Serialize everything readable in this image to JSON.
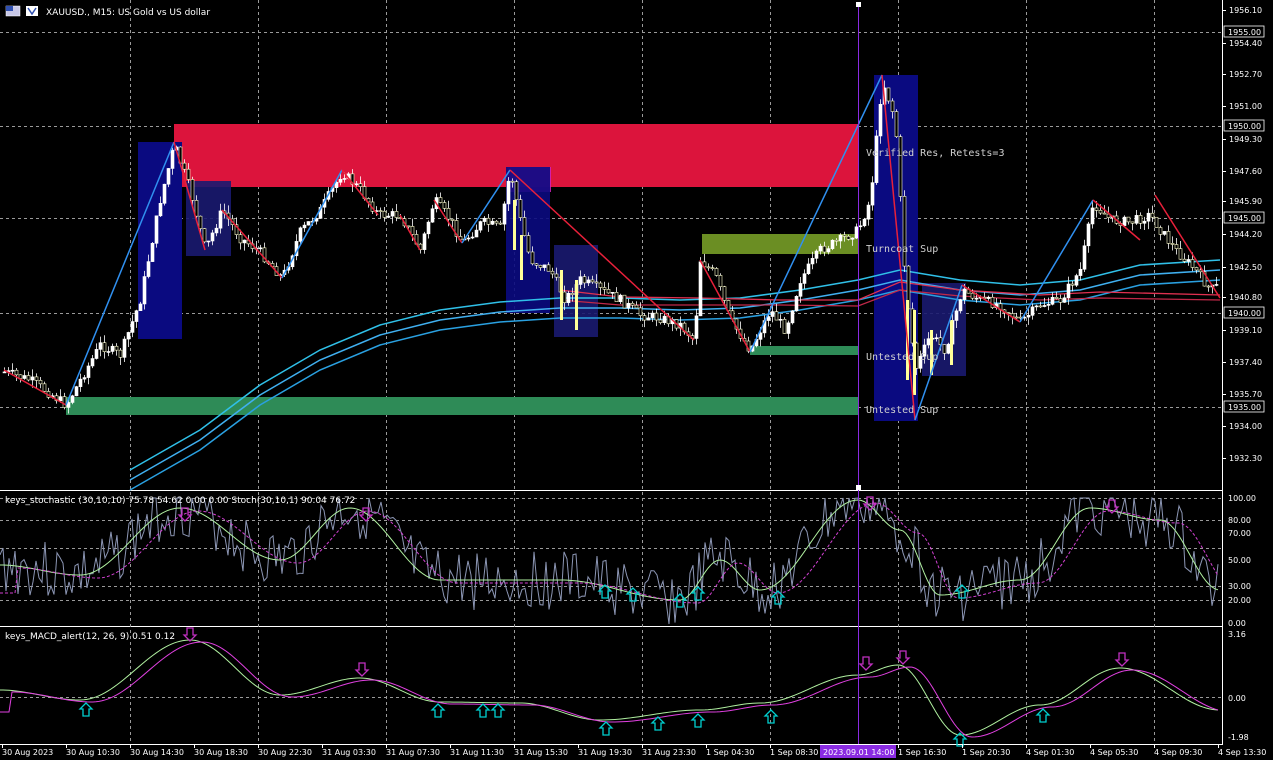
{
  "window": {
    "symbol_title": "XAUUSD., M15:  US Gold vs US dollar"
  },
  "indicators": {
    "stoch_label": "keys_stochastic (30,10,10) 75.78 54.62 0.00 0.00 Stoch(30,10,1) 90.04 76.72",
    "macd_label": "keys_MACD_alert(12, 26, 9) 0.51 0.12"
  },
  "zones": {
    "verified_res": "Verified Res, Retests=3",
    "turncoat_sup": "Turncoat Sup",
    "untested_sup_1": "Untested Sup",
    "untested_sup_2": "Untested Sup"
  },
  "price_axis": {
    "ticks": [
      "1956.10",
      "1954.40",
      "1952.70",
      "1951.00",
      "1949.30",
      "1947.60",
      "1945.90",
      "1944.20",
      "1942.50",
      "1940.80",
      "1939.10",
      "1937.40",
      "1935.70",
      "1934.00",
      "1932.30"
    ],
    "highlighted": [
      "1955.00",
      "1950.00",
      "1945.00",
      "1940.00",
      "1935.00"
    ]
  },
  "stoch_axis": {
    "ticks": [
      "100.00",
      "80.00",
      "70.00",
      "50.00",
      "30.00",
      "20.00",
      "0.00"
    ]
  },
  "macd_axis": {
    "ticks": [
      "3.16",
      "0.00",
      "-1.98"
    ]
  },
  "time_axis": {
    "labels": [
      "30 Aug 2023",
      "30 Aug 10:30",
      "30 Aug 14:30",
      "30 Aug 18:30",
      "30 Aug 22:30",
      "31 Aug 03:30",
      "31 Aug 07:30",
      "31 Aug 11:30",
      "31 Aug 15:30",
      "31 Aug 19:30",
      "31 Aug 23:30",
      "1 Sep 04:30",
      "1 Sep 08:30",
      "",
      "1 Sep 16:30",
      "1 Sep 20:30",
      "4 Sep 01:30",
      "4 Sep 05:30",
      "4 Sep 09:30",
      "4 Sep 13:30"
    ],
    "crosshair_label": "2023.09.01 14:00"
  },
  "colors": {
    "background": "#000000",
    "resistance_zone": "#dc143c",
    "support_zone": "#2e8b57",
    "turncoat_zone": "#6b8e23",
    "box_blue": "#0a0a80",
    "ma_blue": "#3fa8e0",
    "ma_red": "#e03050",
    "crosshair": "#8a2be2",
    "up_arrow": "#00d0d0",
    "down_arrow": "#c030c0"
  }
}
